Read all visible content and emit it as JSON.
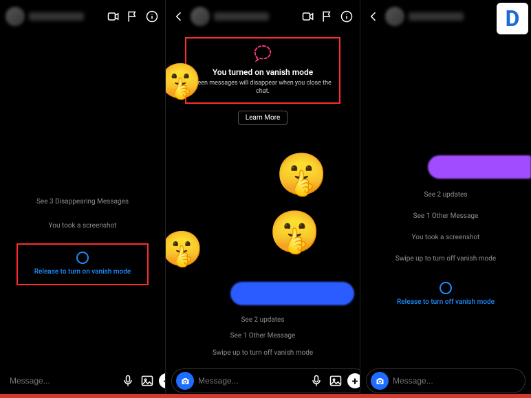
{
  "icons": {
    "back": "chevron-left",
    "video": "video",
    "flag": "flag",
    "info": "info",
    "camera": "camera",
    "mic": "mic",
    "gallery": "image",
    "plus": "+"
  },
  "compose": {
    "placeholder": "Message..."
  },
  "panel1": {
    "status1": "See 3 Disappearing Messages",
    "status2": "You took a screenshot",
    "action": "Release to turn on vanish mode"
  },
  "panel2": {
    "notice_title": "You turned on vanish mode",
    "notice_sub": "Seen messages will disappear when you close the chat.",
    "learn_more": "Learn More",
    "see_updates": "See 2 updates",
    "see_other": "See 1 Other Message",
    "swipe_hint": "Swipe up to turn off vanish mode"
  },
  "panel3": {
    "see_updates": "See 2 updates",
    "see_other": "See 1 Other Message",
    "screenshot": "You took a screenshot",
    "swipe_hint": "Swipe up to turn off vanish mode",
    "action": "Release to turn off vanish mode"
  },
  "badge": "D"
}
